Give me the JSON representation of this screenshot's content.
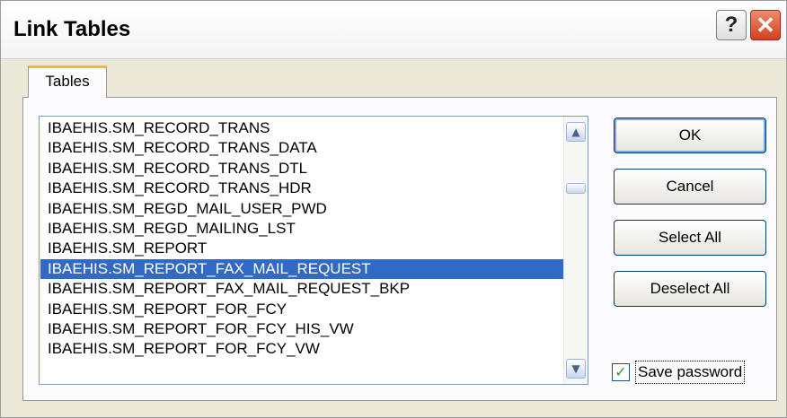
{
  "window": {
    "title": "Link Tables",
    "help_glyph": "?",
    "close_glyph": "✕"
  },
  "tab": {
    "label": "Tables"
  },
  "list": {
    "items": [
      "IBAEHIS.SM_RECORD_TRANS",
      "IBAEHIS.SM_RECORD_TRANS_DATA",
      "IBAEHIS.SM_RECORD_TRANS_DTL",
      "IBAEHIS.SM_RECORD_TRANS_HDR",
      "IBAEHIS.SM_REGD_MAIL_USER_PWD",
      "IBAEHIS.SM_REGD_MAILING_LST",
      "IBAEHIS.SM_REPORT",
      "IBAEHIS.SM_REPORT_FAX_MAIL_REQUEST",
      "IBAEHIS.SM_REPORT_FAX_MAIL_REQUEST_BKP",
      "IBAEHIS.SM_REPORT_FOR_FCY",
      "IBAEHIS.SM_REPORT_FOR_FCY_HIS_VW",
      "IBAEHIS.SM_REPORT_FOR_FCY_VW"
    ],
    "selected": "IBAEHIS.SM_REPORT_FAX_MAIL_REQUEST",
    "selection_color": "#316ac5",
    "scroll_up_icon": "chevron-up-icon",
    "scroll_down_icon": "chevron-down-icon"
  },
  "buttons": {
    "ok": "OK",
    "cancel": "Cancel",
    "select_all": "Select All",
    "deselect_all": "Deselect All"
  },
  "save_password": {
    "label": "Save password",
    "checked": true
  },
  "colors": {
    "dialog_bg": "#ece9d8",
    "tab_highlight": "#f7b53a",
    "close_button": "#d3411f"
  }
}
